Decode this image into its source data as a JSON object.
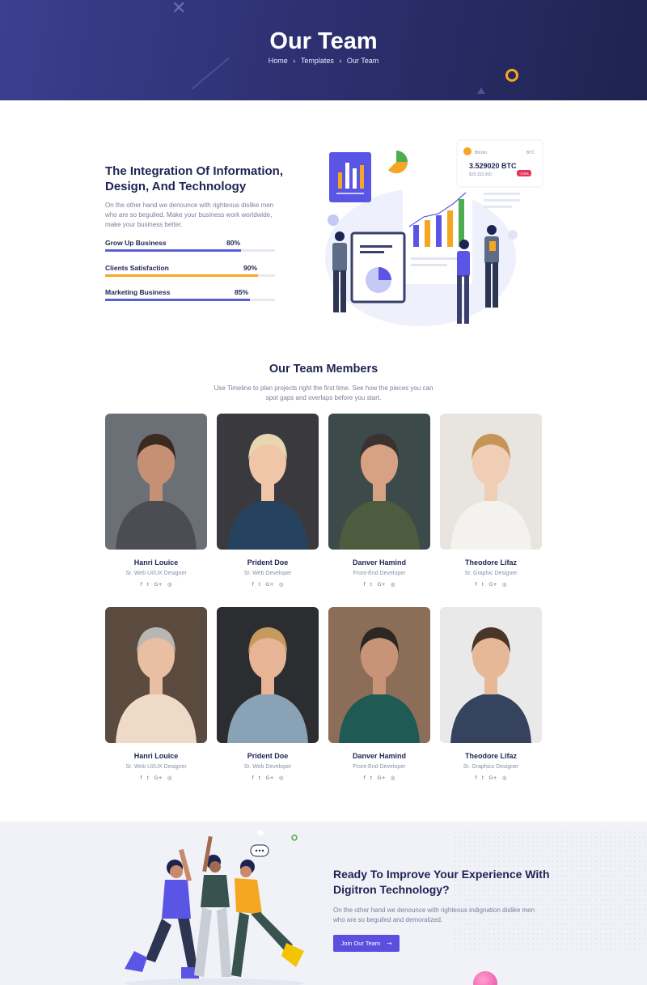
{
  "hero": {
    "title": "Our Team",
    "breadcrumb": [
      "Home",
      "Templates",
      "Our Team"
    ],
    "separator": "›"
  },
  "integration": {
    "title": "The Integration Of Information, Design, And Technology",
    "description": "On the other hand we denounce with righteous dislike men who are so beguiled. Make your business work worldwide, make your business better.",
    "skills": [
      {
        "label": "Grow Up Business",
        "percent": "80%",
        "value": 80,
        "color": "#5b5fd6"
      },
      {
        "label": "Clients Satisfaction",
        "percent": "90%",
        "value": 90,
        "color": "#f5a623"
      },
      {
        "label": "Marketing Business",
        "percent": "85%",
        "value": 85,
        "color": "#5b5fd6"
      }
    ],
    "crypto_card": {
      "coin": "Bitcoin",
      "symbol": "BTC",
      "value": "3.529020 BTC",
      "sub": "$19,153,000",
      "change": "-3.5%"
    }
  },
  "team": {
    "heading": "Our Team Members",
    "subtitle": "Use Timeline to plan projects right the first time. See how the pieces you can spot gaps and overlaps before you start.",
    "members": [
      {
        "name": "Hanri Louice",
        "role": "Sr. Web UI/UX Designer",
        "bg": "#6b6f76",
        "skin": "#c69074",
        "hair": "#3b2a20",
        "shirt": "#4b4d52"
      },
      {
        "name": "Prident Doe",
        "role": "Sr. Web Developer",
        "bg": "#3a3a3e",
        "skin": "#f0c6a8",
        "hair": "#e9d6b0",
        "shirt": "#27425e"
      },
      {
        "name": "Danver Hamind",
        "role": "Front-End Developer",
        "bg": "#3c4a4a",
        "skin": "#d7a183",
        "hair": "#3a3230",
        "shirt": "#4d5b3f"
      },
      {
        "name": "Theodore Lifaz",
        "role": "Sr. Graphic Designer",
        "bg": "#e8e4df",
        "skin": "#f0cdb5",
        "hair": "#c69455",
        "shirt": "#f4f2ee"
      },
      {
        "name": "Hanri Louice",
        "role": "Sr. Web UI/UX Designer",
        "bg": "#5b4a3e",
        "skin": "#e8bfa3",
        "hair": "#b8b6b2",
        "shirt": "#efd9c7"
      },
      {
        "name": "Prident Doe",
        "role": "Sr. Web Developer",
        "bg": "#2c2d30",
        "skin": "#e7b495",
        "hair": "#c49a5f",
        "shirt": "#8aa2b6"
      },
      {
        "name": "Danver Hamind",
        "role": "Front-End Developer",
        "bg": "#8c6e58",
        "skin": "#c89477",
        "hair": "#2c2624",
        "shirt": "#1f5a55"
      },
      {
        "name": "Theodore Lifaz",
        "role": "Sr. Graphics Designer",
        "bg": "#e9e9e9",
        "skin": "#e6b898",
        "hair": "#4a3628",
        "shirt": "#36435e"
      }
    ],
    "social": [
      "f",
      "t",
      "G+",
      "◎"
    ]
  },
  "cta": {
    "title": "Ready To Improve Your Experience With Digitron Technology?",
    "description": "On the other hand we denounce with righteous indignation dislike men who are so beguiled and demoralized.",
    "button": "Join Our Team",
    "button_arrow": "→"
  }
}
